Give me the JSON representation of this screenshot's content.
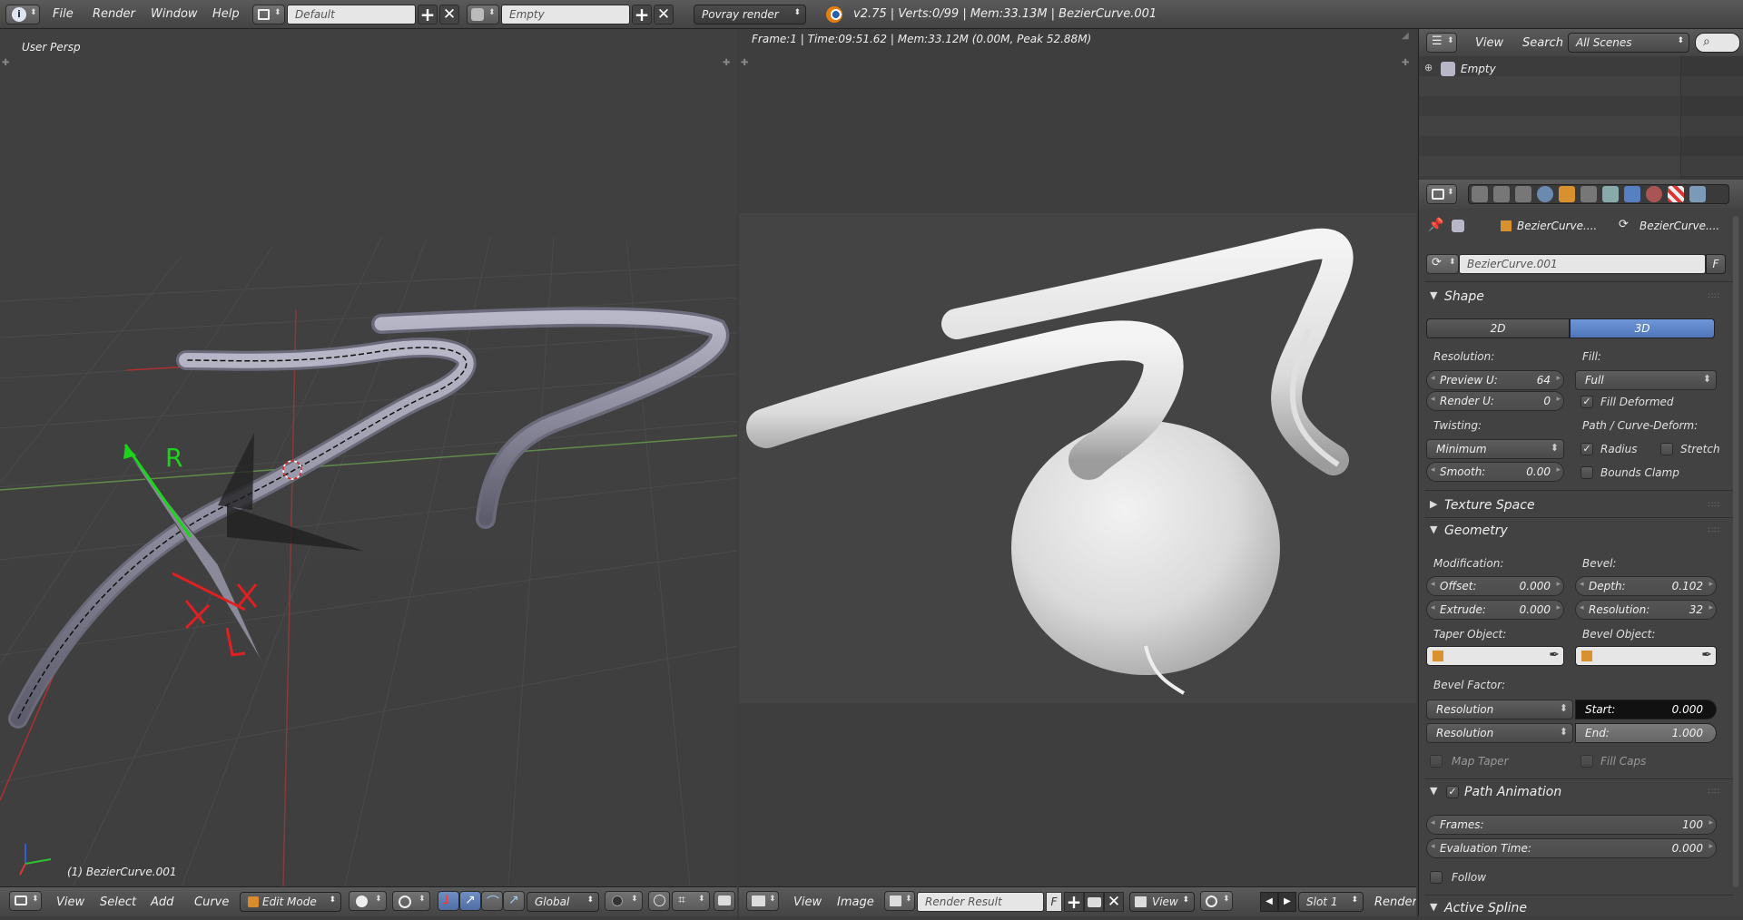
{
  "topbar": {
    "menus": [
      "File",
      "Render",
      "Window",
      "Help"
    ],
    "layout_name": "Default",
    "scene_name": "Empty",
    "render_engine": "Povray render",
    "stats": "v2.75 | Verts:0/99 | Mem:33.13M | BezierCurve.001"
  },
  "viewport": {
    "view_label": "User Persp",
    "object_label": "(1) BezierCurve.001",
    "menus": [
      "View",
      "Select",
      "Add",
      "Curve"
    ],
    "mode": "Edit Mode",
    "orientation": "Global"
  },
  "image_editor": {
    "info": "Frame:1 | Time:09:51.62 | Mem:33.12M (0.00M, Peak 52.88M)",
    "menus": [
      "View",
      "Image"
    ],
    "image_name": "Render Result",
    "f_label": "F",
    "view_dropdown": "View",
    "slot": "Slot 1",
    "render_layer": "RenderL"
  },
  "outliner": {
    "menus": [
      "View",
      "Search"
    ],
    "scene_filter": "All Scenes",
    "root_item": "Empty"
  },
  "properties": {
    "breadcrumb_obj": "BezierCurve....",
    "breadcrumb_data": "BezierCurve....",
    "datablock_name": "BezierCurve.001",
    "datablock_f": "F",
    "shape": {
      "title": "Shape",
      "btn_2d": "2D",
      "btn_3d": "3D",
      "resolution_label": "Resolution:",
      "fill_label": "Fill:",
      "preview_u_label": "Preview U:",
      "preview_u": "64",
      "render_u_label": "Render U:",
      "render_u": "0",
      "fill_value": "Full",
      "fill_deformed": "Fill Deformed",
      "twisting_label": "Twisting:",
      "path_deform_label": "Path / Curve-Deform:",
      "twisting_value": "Minimum",
      "radius": "Radius",
      "stretch": "Stretch",
      "smooth_label": "Smooth:",
      "smooth": "0.00",
      "bounds_clamp": "Bounds Clamp"
    },
    "texture_space": "Texture Space",
    "geometry": {
      "title": "Geometry",
      "modification_label": "Modification:",
      "bevel_label": "Bevel:",
      "offset_label": "Offset:",
      "offset": "0.000",
      "depth_label": "Depth:",
      "depth": "0.102",
      "extrude_label": "Extrude:",
      "extrude": "0.000",
      "bevel_res_label": "Resolution:",
      "bevel_res": "32",
      "taper_object_label": "Taper Object:",
      "bevel_object_label": "Bevel Object:",
      "bevel_factor_label": "Bevel Factor:",
      "bf_mode_1": "Resolution",
      "bf_mode_2": "Resolution",
      "start_label": "Start:",
      "start": "0.000",
      "end_label": "End:",
      "end": "1.000",
      "map_taper": "Map Taper",
      "fill_caps": "Fill Caps"
    },
    "path_animation": {
      "title": "Path Animation",
      "frames_label": "Frames:",
      "frames": "100",
      "eval_time_label": "Evaluation Time:",
      "eval_time": "0.000",
      "follow": "Follow"
    },
    "active_spline": "Active Spline"
  }
}
